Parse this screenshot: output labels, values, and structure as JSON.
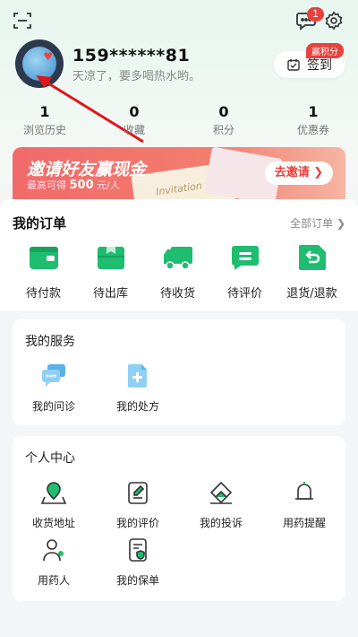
{
  "top_bar": {
    "message_badge": "1"
  },
  "profile": {
    "phone": "159******81",
    "tip": "天凉了，要多喝热水哟。",
    "signin_label": "签到",
    "signin_tag": "赢积分"
  },
  "stats": [
    {
      "value": "1",
      "label": "浏览历史"
    },
    {
      "value": "0",
      "label": "收藏"
    },
    {
      "value": "0",
      "label": "积分"
    },
    {
      "value": "1",
      "label": "优惠券"
    }
  ],
  "banner": {
    "title": "邀请好友赢现金",
    "sub_prefix": "最高可得",
    "sub_amount": "500",
    "sub_suffix": "元/人",
    "card_text": "Invitation",
    "button": "去邀请 ❯"
  },
  "orders": {
    "title": "我的订单",
    "all_link": "全部订单 ❯",
    "items": [
      {
        "label": "待付款",
        "icon": "wallet-icon"
      },
      {
        "label": "待出库",
        "icon": "box-icon"
      },
      {
        "label": "待收货",
        "icon": "truck-icon"
      },
      {
        "label": "待评价",
        "icon": "comment-icon"
      },
      {
        "label": "退货/退款",
        "icon": "return-icon"
      }
    ]
  },
  "services": {
    "title": "我的服务",
    "items": [
      {
        "label": "我的问诊",
        "icon": "consultation-icon"
      },
      {
        "label": "我的处方",
        "icon": "prescription-icon"
      }
    ]
  },
  "personal": {
    "title": "个人中心",
    "items": [
      {
        "label": "收货地址",
        "icon": "location-icon"
      },
      {
        "label": "我的评价",
        "icon": "review-icon"
      },
      {
        "label": "我的投诉",
        "icon": "complaint-icon"
      },
      {
        "label": "用药提醒",
        "icon": "bell-icon"
      },
      {
        "label": "用药人",
        "icon": "patient-icon"
      },
      {
        "label": "我的保单",
        "icon": "policy-icon"
      }
    ]
  },
  "colors": {
    "accent_green": "#1ebd6f",
    "badge_red": "#e8423f",
    "icon_blue": "#5ab1e8"
  }
}
